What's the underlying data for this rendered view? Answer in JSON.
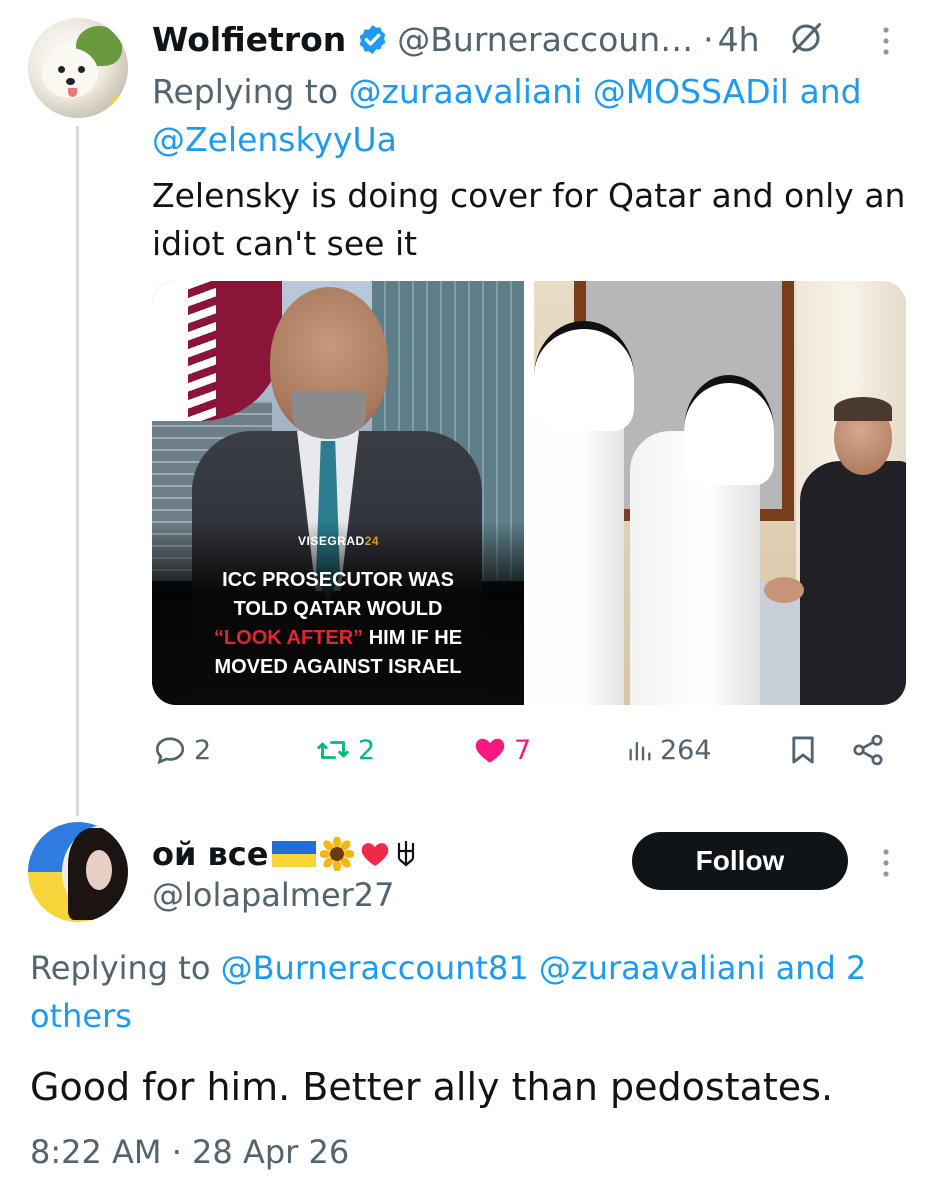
{
  "tweet1": {
    "author_name": "Wolfietron",
    "handle": "@Burneraccoun…",
    "separator": "·",
    "time": "4h",
    "replying_prefix": "Replying to",
    "mention1": "@zuraavaliani",
    "mention2": "@MOSSADil",
    "and_word": "and",
    "mention3": "@ZelenskyyUa",
    "text": "Zelensky is doing cover for Qatar and only an idiot can't see it",
    "media_left": {
      "brand_main": "VISEGRAD",
      "brand_num": "24",
      "headline_line1": "ICC PROSECUTOR WAS",
      "headline_line2": "TOLD QATAR WOULD",
      "headline_highlight": "“LOOK AFTER”",
      "headline_line3_rest": " HIM IF HE",
      "headline_line4": "MOVED AGAINST ISRAEL"
    },
    "stats": {
      "replies": "2",
      "reposts": "2",
      "likes": "7",
      "views": "264"
    }
  },
  "tweet2": {
    "author_name": "ой все",
    "handle": "@lolapalmer27",
    "follow_label": "Follow",
    "replying_prefix": "Replying to",
    "mention1": "@Burneraccount81",
    "mention2": "@zuraavaliani",
    "others": "and 2 others",
    "text": "Good for him. Better ally than pedostates.",
    "time": "8:22 AM",
    "separator": "·",
    "date": "28 Apr 26"
  },
  "colors": {
    "link": "#1d9bf0",
    "muted": "#536471",
    "repost_active": "#00ba7c",
    "like_active": "#f91880",
    "verified": "#1d9bf0",
    "follow_bg": "#0f1419"
  },
  "icons": [
    "verified-badge-icon",
    "grok-icon",
    "more-icon",
    "reply-icon",
    "repost-icon",
    "heart-icon",
    "views-icon",
    "bookmark-icon",
    "share-icon",
    "ukraine-flag-icon",
    "sunflower-icon",
    "red-heart-icon",
    "tryzub-icon"
  ]
}
